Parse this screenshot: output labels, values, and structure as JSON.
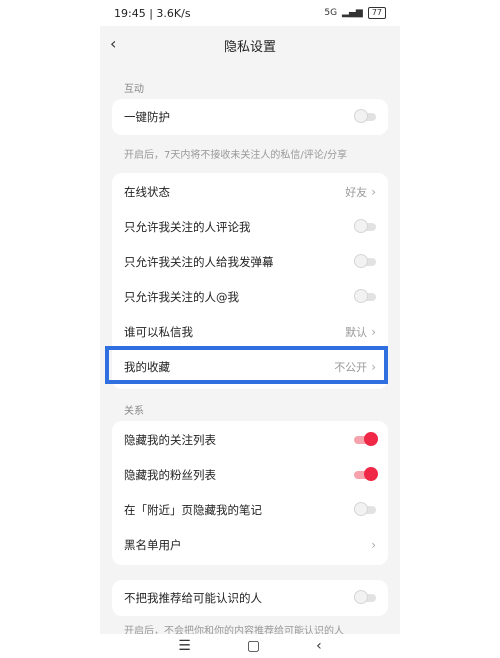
{
  "status": {
    "time": "19:45 | 3.6K/s",
    "network": "5G",
    "battery": "77"
  },
  "header": {
    "back_icon": "chevron-left-icon",
    "title": "隐私设置"
  },
  "sections": {
    "interaction": "互动",
    "relationship": "关系"
  },
  "items": {
    "one_click": {
      "label": "一键防护",
      "enabled": false
    },
    "one_click_desc": "开启后，7天内将不接收未关注人的私信/评论/分享",
    "online_status": {
      "label": "在线状态",
      "value": "好友"
    },
    "comments": {
      "label": "只允许我关注的人评论我",
      "enabled": false
    },
    "danmu": {
      "label": "只允许我关注的人给我发弹幕",
      "enabled": false
    },
    "mention": {
      "label": "只允许我关注的人@我",
      "enabled": false
    },
    "message": {
      "label": "谁可以私信我",
      "value": "默认"
    },
    "favorites": {
      "label": "我的收藏",
      "value": "不公开"
    },
    "hide_following": {
      "label": "隐藏我的关注列表",
      "enabled": true
    },
    "hide_fans": {
      "label": "隐藏我的粉丝列表",
      "enabled": true
    },
    "hide_nearby": {
      "label": "在「附近」页隐藏我的笔记",
      "enabled": false
    },
    "blacklist": {
      "label": "黑名单用户"
    },
    "no_recommend": {
      "label": "不把我推荐给可能认识的人",
      "enabled": false
    },
    "no_recommend_desc": "开启后，不会把你和你的内容推荐给可能认识的人"
  },
  "nav": {
    "menu": "☰",
    "home": "▢",
    "back": "‹"
  },
  "colors": {
    "accent": "#ef2847",
    "highlight": "#2f6fe0"
  }
}
